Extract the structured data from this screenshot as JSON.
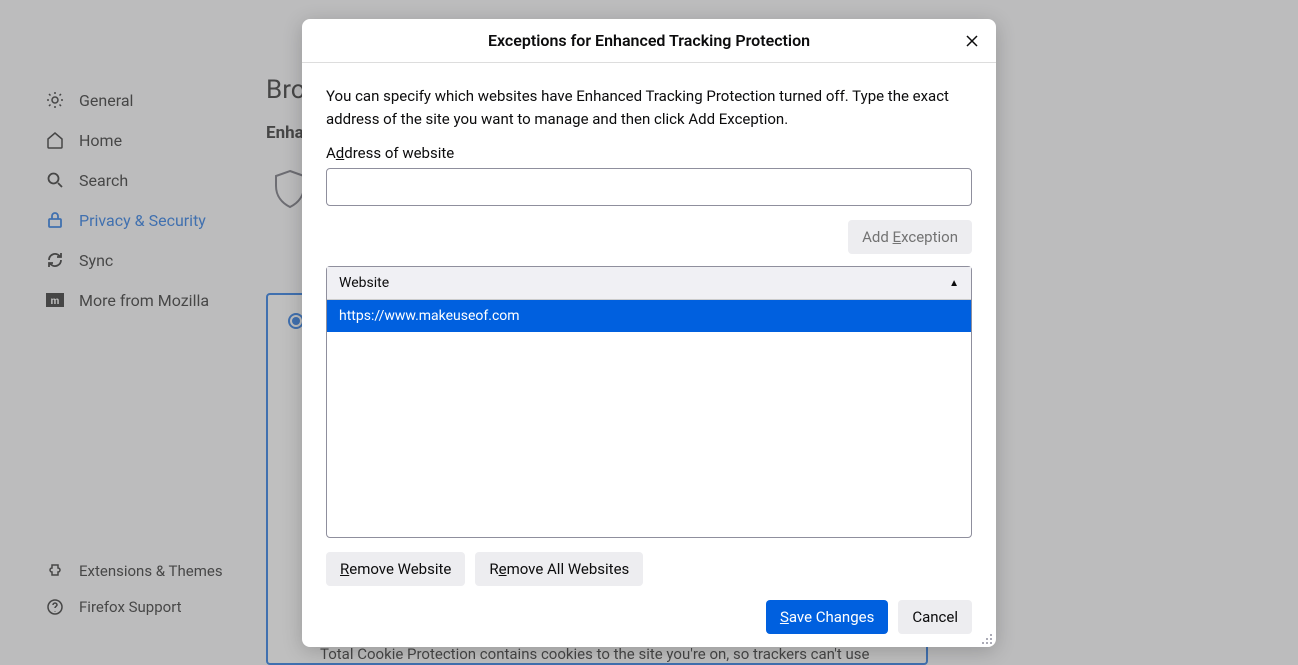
{
  "sidebar": {
    "items": [
      {
        "label": "General"
      },
      {
        "label": "Home"
      },
      {
        "label": "Search"
      },
      {
        "label": "Privacy & Security"
      },
      {
        "label": "Sync"
      },
      {
        "label": "More from Mozilla"
      }
    ]
  },
  "bottom_links": {
    "extensions": "Extensions & Themes",
    "support": "Firefox Support"
  },
  "page": {
    "title_fragment": "Brow",
    "section_fragment": "Enha",
    "cookie_text": "Total Cookie Protection contains cookies to the site you're on, so trackers can't use"
  },
  "dialog": {
    "title": "Exceptions for Enhanced Tracking Protection",
    "description": "You can specify which websites have Enhanced Tracking Protection turned off. Type the exact address of the site you want to manage and then click Add Exception.",
    "address_label_pre": "A",
    "address_label_u": "d",
    "address_label_post": "dress of website",
    "address_value": "",
    "add_pre": "Add ",
    "add_u": "E",
    "add_post": "xception",
    "list_header": "Website",
    "entries": [
      {
        "url": "https://www.makeuseof.com"
      }
    ],
    "remove_u": "R",
    "remove_post": "emove Website",
    "remove_all_pre": "R",
    "remove_all_u": "e",
    "remove_all_post": "move All Websites",
    "save_u": "S",
    "save_post": "ave Changes",
    "cancel": "Cancel"
  }
}
